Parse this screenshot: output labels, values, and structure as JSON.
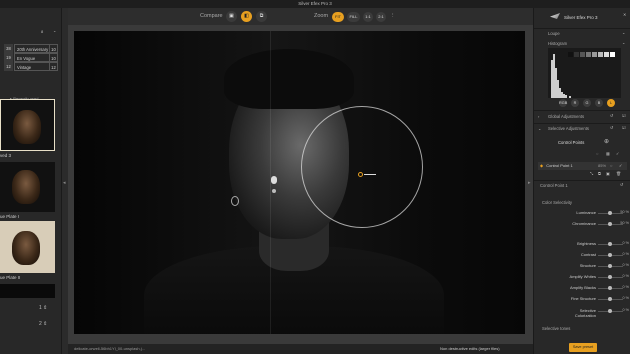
{
  "app": {
    "title": "Silver Efex Pro 3"
  },
  "toolbar": {
    "compare_label": "Compare",
    "zoom_label": "Zoom",
    "zoom_fit": "FIT",
    "zoom_fill": "FILL",
    "zoom_1_1": "1:1",
    "zoom_2_1": "2:1",
    "zoom_more": "⋮"
  },
  "left": {
    "top_count": "8",
    "history": [
      {
        "n": "38",
        "name": "20th Anniversary",
        "count": "10"
      },
      {
        "n": "19",
        "name": "En Vogue",
        "count": "10"
      },
      {
        "n": "12",
        "name": "Vintage",
        "count": "12"
      }
    ],
    "recently_used": "▸ Recently used",
    "thumbs": [
      {
        "label": "ved 3"
      },
      {
        "label": "ue Plate I"
      },
      {
        "label": "ue Plate II"
      }
    ],
    "pager_a": "1 ⇕",
    "pager_b": "2 ⇕"
  },
  "right": {
    "brand": "Silver Efex Pro 3",
    "loupe": "Loupe",
    "histogram": "Histogram",
    "channels": [
      "RGB",
      "R",
      "G",
      "B",
      "L"
    ],
    "global_adjustments": "Global Adjustments",
    "selective_adjustments": "Selective Adjustments",
    "control_points": "Control Points",
    "control_point_row": "Control Point 1",
    "control_point_pct": "85%",
    "control_point_section": "Control Point 1",
    "color_selectivity": "Color Selectivity",
    "sliders": [
      {
        "label": "Luminance",
        "value": "50 %"
      },
      {
        "label": "Chrominance",
        "value": "50 %"
      },
      {
        "label": "Brightness",
        "value": "0 %"
      },
      {
        "label": "Contrast",
        "value": "0 %"
      },
      {
        "label": "Structure",
        "value": "0 %"
      },
      {
        "label": "Amplify Whites",
        "value": "0 %"
      },
      {
        "label": "Amplify Blacks",
        "value": "0 %"
      },
      {
        "label": "Fine Structure",
        "value": "0 %"
      },
      {
        "label": "Selective Colorization",
        "value": "0 %"
      }
    ],
    "selective_tones": "Selective tones",
    "save_preset": "Save preset"
  },
  "status": {
    "filename": "delicate-orwell-56bh1Yl_00-unsplash.j...",
    "mode": "Non destructive edits (larger files)"
  }
}
